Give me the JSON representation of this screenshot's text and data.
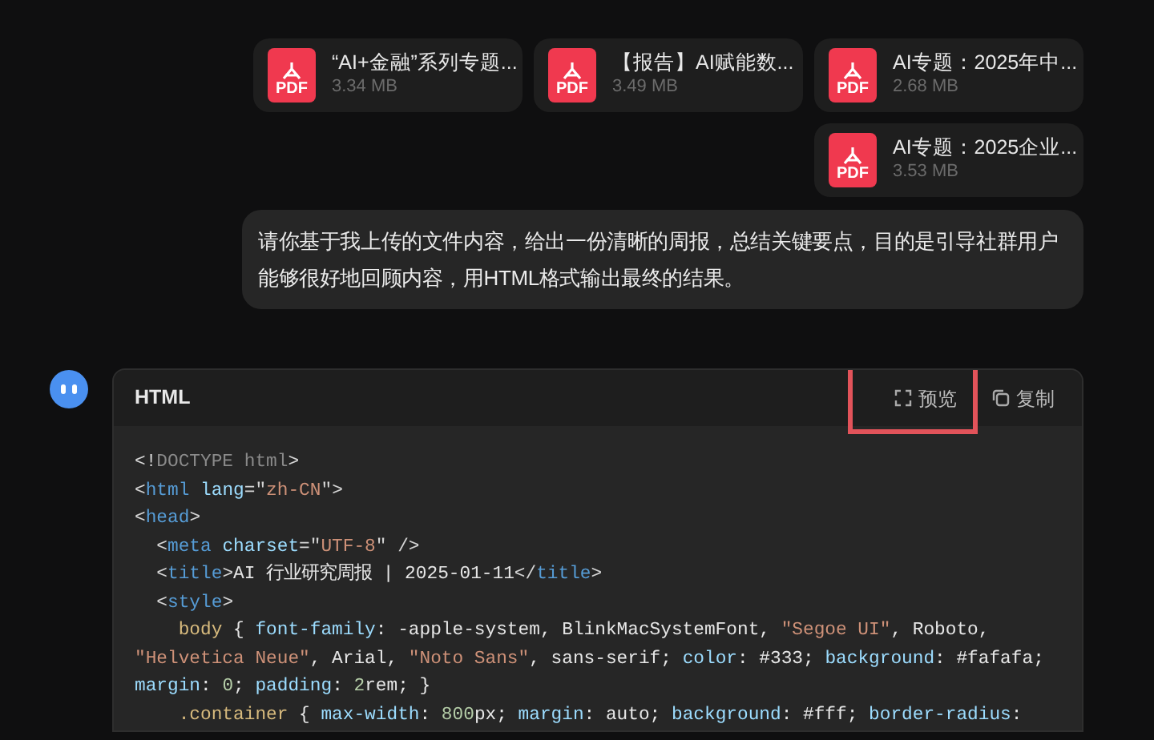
{
  "attachments": [
    {
      "name": "“AI+金融”系列专题...",
      "size": "3.34 MB",
      "type": "PDF"
    },
    {
      "name": "【报告】AI赋能数...",
      "size": "3.49 MB",
      "type": "PDF"
    },
    {
      "name": "AI专题：2025年中...",
      "size": "2.68 MB",
      "type": "PDF"
    },
    {
      "name": "AI专题：2025企业...",
      "size": "3.53 MB",
      "type": "PDF"
    }
  ],
  "user_message": "请你基于我上传的文件内容，给出一份清晰的周报，总结关键要点，目的是引导社群用户能够很好地回顾内容，用HTML格式输出最终的结果。",
  "code_block": {
    "language": "HTML",
    "actions": [
      {
        "kind": "preview",
        "label": "预览",
        "highlighted": true
      },
      {
        "kind": "copy",
        "label": "复制",
        "highlighted": false
      }
    ],
    "lines": [
      [
        {
          "kind": "punct",
          "text": "<!"
        },
        {
          "kind": "doctype",
          "text": "DOCTYPE html"
        },
        {
          "kind": "punct",
          "text": ">"
        }
      ],
      [
        {
          "kind": "punct",
          "text": "<"
        },
        {
          "kind": "tag",
          "text": "html"
        },
        {
          "kind": "attr",
          "text": " lang"
        },
        {
          "kind": "punct",
          "text": "=\""
        },
        {
          "kind": "string",
          "text": "zh-CN"
        },
        {
          "kind": "punct",
          "text": "\">"
        }
      ],
      [
        {
          "kind": "punct",
          "text": "<"
        },
        {
          "kind": "tag",
          "text": "head"
        },
        {
          "kind": "punct",
          "text": ">"
        }
      ],
      [
        {
          "kind": "punct",
          "text": "  <"
        },
        {
          "kind": "tag",
          "text": "meta"
        },
        {
          "kind": "attr",
          "text": " charset"
        },
        {
          "kind": "punct",
          "text": "=\""
        },
        {
          "kind": "string",
          "text": "UTF-8"
        },
        {
          "kind": "punct",
          "text": "\" />"
        }
      ],
      [
        {
          "kind": "punct",
          "text": "  <"
        },
        {
          "kind": "tag",
          "text": "title"
        },
        {
          "kind": "punct",
          "text": ">"
        },
        {
          "kind": "text",
          "text": "AI 行业研究周报 | 2025-01-11"
        },
        {
          "kind": "punct",
          "text": "</"
        },
        {
          "kind": "tag",
          "text": "title"
        },
        {
          "kind": "punct",
          "text": ">"
        }
      ],
      [
        {
          "kind": "punct",
          "text": "  <"
        },
        {
          "kind": "tag",
          "text": "style"
        },
        {
          "kind": "punct",
          "text": ">"
        }
      ],
      [
        {
          "kind": "selector",
          "text": "    body"
        },
        {
          "kind": "text",
          "text": " { "
        },
        {
          "kind": "prop",
          "text": "font-family"
        },
        {
          "kind": "text",
          "text": ": -apple-system, BlinkMacSystemFont, "
        },
        {
          "kind": "string",
          "text": "\"Segoe UI\""
        },
        {
          "kind": "text",
          "text": ", Roboto,"
        }
      ],
      [
        {
          "kind": "string",
          "text": "\"Helvetica Neue\""
        },
        {
          "kind": "text",
          "text": ", Arial, "
        },
        {
          "kind": "string",
          "text": "\"Noto Sans\""
        },
        {
          "kind": "text",
          "text": ", sans-serif; "
        },
        {
          "kind": "prop",
          "text": "color"
        },
        {
          "kind": "text",
          "text": ": #333; "
        },
        {
          "kind": "prop",
          "text": "background"
        },
        {
          "kind": "text",
          "text": ": #fafafa;"
        }
      ],
      [
        {
          "kind": "prop",
          "text": "margin"
        },
        {
          "kind": "text",
          "text": ": "
        },
        {
          "kind": "number",
          "text": "0"
        },
        {
          "kind": "text",
          "text": "; "
        },
        {
          "kind": "prop",
          "text": "padding"
        },
        {
          "kind": "text",
          "text": ": "
        },
        {
          "kind": "number",
          "text": "2"
        },
        {
          "kind": "text",
          "text": "rem; }"
        }
      ],
      [
        {
          "kind": "selector",
          "text": "    .container"
        },
        {
          "kind": "text",
          "text": " { "
        },
        {
          "kind": "prop",
          "text": "max-width"
        },
        {
          "kind": "text",
          "text": ": "
        },
        {
          "kind": "number",
          "text": "800"
        },
        {
          "kind": "text",
          "text": "px; "
        },
        {
          "kind": "prop",
          "text": "margin"
        },
        {
          "kind": "text",
          "text": ": auto; "
        },
        {
          "kind": "prop",
          "text": "background"
        },
        {
          "kind": "text",
          "text": ": #fff; "
        },
        {
          "kind": "prop",
          "text": "border-radius"
        },
        {
          "kind": "text",
          "text": ":"
        }
      ]
    ]
  }
}
